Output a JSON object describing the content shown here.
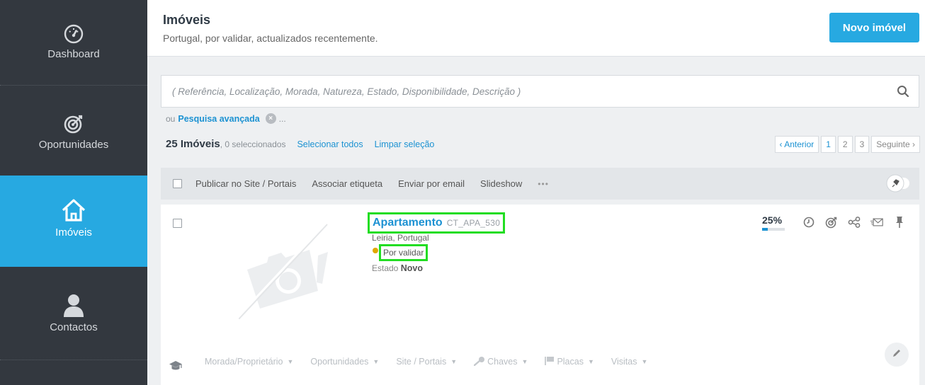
{
  "sidebar": {
    "items": [
      {
        "label": "Dashboard",
        "icon": "dashboard-gauge-icon",
        "active": false
      },
      {
        "label": "Oportunidades",
        "icon": "target-icon",
        "active": false
      },
      {
        "label": "Imóveis",
        "icon": "house-icon",
        "active": true
      },
      {
        "label": "Contactos",
        "icon": "person-icon",
        "active": false
      }
    ]
  },
  "header": {
    "title": "Imóveis",
    "subtitle": "Portugal, por validar, actualizados recentemente.",
    "new_button": "Novo imóvel"
  },
  "search": {
    "placeholder": "( Referência, Localização, Morada, Natureza, Estado, Disponibilidade, Descrição )",
    "or_text": "ou",
    "advanced_link": "Pesquisa avançada",
    "ellipsis": "..."
  },
  "results": {
    "count": "25 Imóveis",
    "selected": ", 0 seleccionados",
    "select_all": "Selecionar todos",
    "clear_selection": "Limpar seleção"
  },
  "pagination": {
    "prev": "‹ Anterior",
    "pages": [
      "1",
      "2",
      "3"
    ],
    "current_page": "1",
    "next": "Seguinte ›"
  },
  "toolbar": {
    "actions": [
      "Publicar no Site / Portais",
      "Associar etiqueta",
      "Enviar por email",
      "Slideshow"
    ],
    "more": "•••"
  },
  "property": {
    "type": "Apartamento",
    "reference": "CT_APA_530",
    "location": "Leiria, Portugal",
    "status": "Por validar",
    "status_color": "#e0a800",
    "estado_label": "Estado",
    "estado_value": "Novo",
    "completeness": "25%",
    "completeness_value": 0.25,
    "action_icons": [
      "clock-icon",
      "target-icon",
      "share-icon",
      "email-envelope-icon",
      "pin-icon"
    ],
    "tabs": [
      "Morada/Proprietário",
      "Oportunidades",
      "Site / Portais",
      "Chaves",
      "Placas",
      "Visitas"
    ]
  },
  "colors": {
    "accent": "#27a9e1",
    "sidebar_bg": "#33383f",
    "link": "#1c92d2"
  }
}
